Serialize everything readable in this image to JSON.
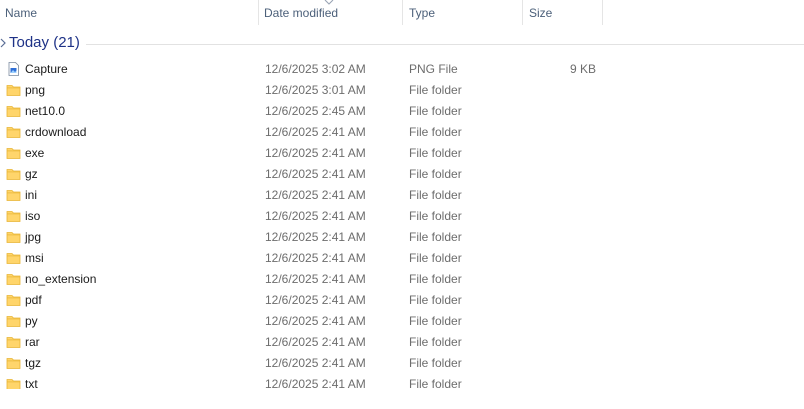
{
  "columns": {
    "name": "Name",
    "date_modified": "Date modified",
    "type": "Type",
    "size": "Size"
  },
  "group": {
    "title": "Today (21)"
  },
  "files": [
    {
      "name": "Capture",
      "date": "12/6/2025 3:02 AM",
      "type": "PNG File",
      "size": "9 KB",
      "icon": "image-file-icon"
    },
    {
      "name": "png",
      "date": "12/6/2025 3:01 AM",
      "type": "File folder",
      "size": "",
      "icon": "folder-icon"
    },
    {
      "name": "net10.0",
      "date": "12/6/2025 2:45 AM",
      "type": "File folder",
      "size": "",
      "icon": "folder-icon"
    },
    {
      "name": "crdownload",
      "date": "12/6/2025 2:41 AM",
      "type": "File folder",
      "size": "",
      "icon": "folder-icon"
    },
    {
      "name": "exe",
      "date": "12/6/2025 2:41 AM",
      "type": "File folder",
      "size": "",
      "icon": "folder-icon"
    },
    {
      "name": "gz",
      "date": "12/6/2025 2:41 AM",
      "type": "File folder",
      "size": "",
      "icon": "folder-icon"
    },
    {
      "name": "ini",
      "date": "12/6/2025 2:41 AM",
      "type": "File folder",
      "size": "",
      "icon": "folder-icon"
    },
    {
      "name": "iso",
      "date": "12/6/2025 2:41 AM",
      "type": "File folder",
      "size": "",
      "icon": "folder-icon"
    },
    {
      "name": "jpg",
      "date": "12/6/2025 2:41 AM",
      "type": "File folder",
      "size": "",
      "icon": "folder-icon"
    },
    {
      "name": "msi",
      "date": "12/6/2025 2:41 AM",
      "type": "File folder",
      "size": "",
      "icon": "folder-icon"
    },
    {
      "name": "no_extension",
      "date": "12/6/2025 2:41 AM",
      "type": "File folder",
      "size": "",
      "icon": "folder-icon"
    },
    {
      "name": "pdf",
      "date": "12/6/2025 2:41 AM",
      "type": "File folder",
      "size": "",
      "icon": "folder-icon"
    },
    {
      "name": "py",
      "date": "12/6/2025 2:41 AM",
      "type": "File folder",
      "size": "",
      "icon": "folder-icon"
    },
    {
      "name": "rar",
      "date": "12/6/2025 2:41 AM",
      "type": "File folder",
      "size": "",
      "icon": "folder-icon"
    },
    {
      "name": "tgz",
      "date": "12/6/2025 2:41 AM",
      "type": "File folder",
      "size": "",
      "icon": "folder-icon"
    },
    {
      "name": "txt",
      "date": "12/6/2025 2:41 AM",
      "type": "File folder",
      "size": "",
      "icon": "folder-icon"
    }
  ],
  "colors": {
    "header_text": "#4c607a",
    "group_title": "#1e3287",
    "folder_fill": "#ffd56b",
    "folder_tab": "#e8b434",
    "secondary_text": "#6d6d6d"
  }
}
